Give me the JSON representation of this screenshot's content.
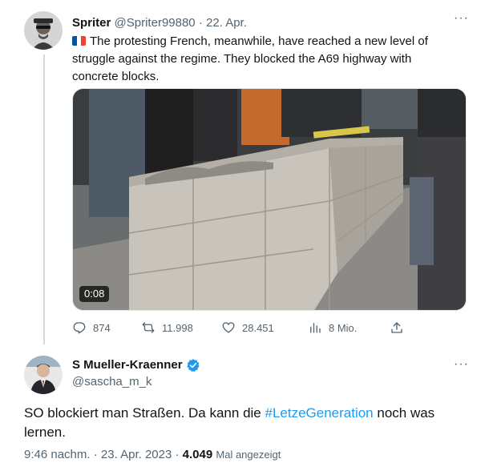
{
  "quoted_tweet": {
    "author_name": "Spriter",
    "author_handle": "@Spriter99880",
    "separator": "·",
    "date": "22. Apr.",
    "more_label": "···",
    "flag": "french-flag",
    "text": "The protesting French, meanwhile, have reached a new level of struggle against the regime. They blocked the A69 highway with concrete blocks.",
    "video_duration": "0:08",
    "actions": {
      "replies": "874",
      "retweets": "11.998",
      "likes": "28.451",
      "views": "8 Mio."
    }
  },
  "main_tweet": {
    "author_name": "S Mueller-Kraenner",
    "verified": true,
    "author_handle": "@sascha_m_k",
    "more_label": "···",
    "text_before": "SO blockiert man Straßen. Da kann die ",
    "hashtag": "#LetzeGeneration",
    "text_after": " noch was lernen.",
    "time": "9:46 nachm.",
    "separator": "·",
    "date": "23. Apr. 2023",
    "separator2": "·",
    "views_count": "4.049",
    "views_label": "Mal angezeigt"
  },
  "colors": {
    "accent": "#1d9bf0",
    "muted": "#536471",
    "text": "#0f1419",
    "flag_blue": "#0055a4",
    "flag_white": "#ffffff",
    "flag_red": "#ef4135"
  }
}
